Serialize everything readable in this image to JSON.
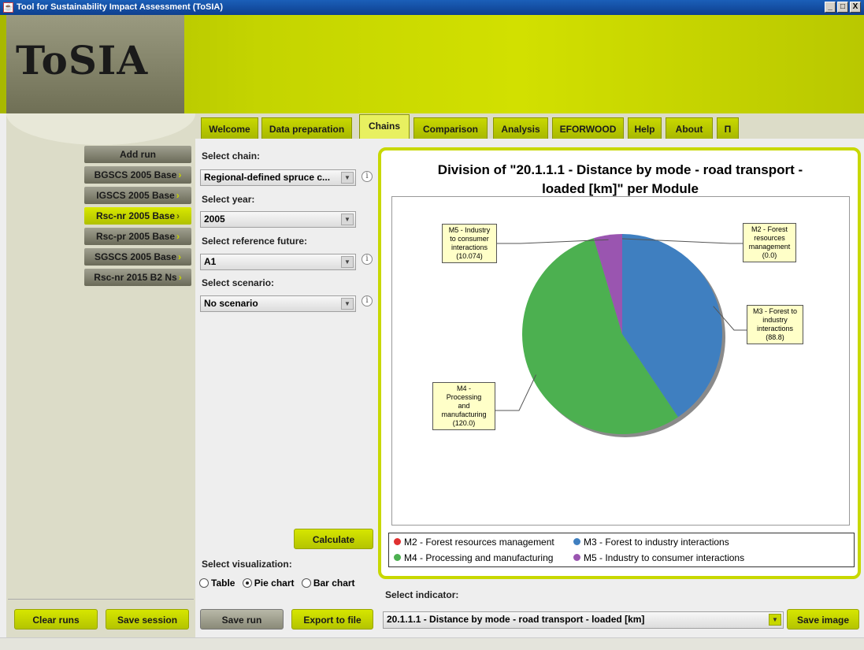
{
  "window": {
    "title": "Tool for Sustainability Impact Assessment (ToSIA)",
    "controls": [
      "_",
      "□",
      "X"
    ]
  },
  "logo": {
    "text": "ToSIA"
  },
  "runs": {
    "add_label": "Add run",
    "items": [
      {
        "label": "BGSCS 2005 Base",
        "selected": false
      },
      {
        "label": "IGSCS 2005 Base",
        "selected": false
      },
      {
        "label": "Rsc-nr 2005 Base",
        "selected": true
      },
      {
        "label": "Rsc-pr 2005 Base",
        "selected": false
      },
      {
        "label": "SGSCS 2005 Base",
        "selected": false
      },
      {
        "label": "Rsc-nr 2015 B2 Ns",
        "selected": false
      }
    ],
    "chevron": "›",
    "clear_label": "Clear runs",
    "save_session_label": "Save session"
  },
  "tabs": [
    {
      "label": "Welcome"
    },
    {
      "label": "Data preparation"
    },
    {
      "label": "Chains",
      "active": true
    },
    {
      "label": "Comparison"
    },
    {
      "label": "Analysis"
    },
    {
      "label": "EFORWOOD"
    },
    {
      "label": "Help"
    },
    {
      "label": "About"
    },
    {
      "label": "Π"
    }
  ],
  "form": {
    "chain_label": "Select chain:",
    "chain_value": "Regional-defined spruce c...",
    "year_label": "Select year:",
    "year_value": "2005",
    "ref_label": "Select reference future:",
    "ref_value": "A1",
    "scenario_label": "Select scenario:",
    "scenario_value": "No scenario",
    "info_glyph": "i",
    "arrow_glyph": "▼",
    "calculate_label": "Calculate",
    "vis_label": "Select visualization:",
    "vis_options": [
      "Table",
      "Pie chart",
      "Bar chart"
    ],
    "vis_selected": "Pie chart",
    "save_run_label": "Save run",
    "export_label": "Export to file"
  },
  "indicator": {
    "label": "Select indicator:",
    "value": "20.1.1.1 - Distance by mode - road transport - loaded [km]",
    "save_image_label": "Save image"
  },
  "colors": {
    "accent": "#c8d800",
    "m2": "#e03030",
    "m3": "#3f7fc0",
    "m4": "#4cb050",
    "m5": "#9a55b0"
  },
  "chart_data": {
    "type": "pie",
    "title_line1": "Division of \"20.1.1.1 - Distance by mode - road transport -",
    "title_line2": "loaded [km]\" per Module",
    "categories": [
      "M2 - Forest resources management",
      "M3 - Forest to industry interactions",
      "M4 - Processing and manufacturing",
      "M5 - Industry to consumer interactions"
    ],
    "values": [
      0.0,
      88.8,
      120.0,
      10.074
    ],
    "value_labels": [
      "(0.0)",
      "(88.8)",
      "(120.0)",
      "(10.074)"
    ],
    "annotations": [
      [
        "M2 - Forest",
        "resources",
        "management",
        "(0.0)"
      ],
      [
        "M3 - Forest to",
        "industry",
        "interactions",
        "(88.8)"
      ],
      [
        "M4 -",
        "Processing",
        "and",
        "manufacturing",
        "(120.0)"
      ],
      [
        "M5 - Industry",
        "to consumer",
        "interactions",
        "(10.074)"
      ]
    ],
    "legend_placement": "bottom"
  }
}
